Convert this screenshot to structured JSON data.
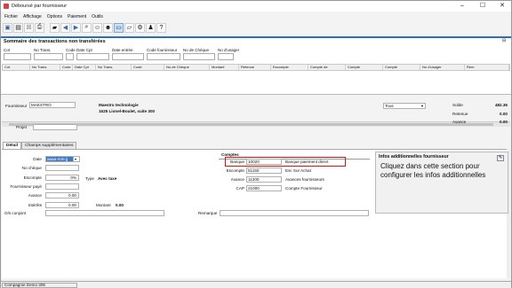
{
  "window": {
    "title": "Déboursé par fournisseur",
    "min": "–",
    "max": "☐",
    "close": "✕"
  },
  "menu": [
    "Fichier",
    "Affichage",
    "Options",
    "Paiement",
    "Outils"
  ],
  "toolbar": {
    "icons": [
      "floppy-icon",
      "new-doc-icon",
      "delete-icon",
      "print-icon",
      "briefcase-icon",
      "back-icon",
      "forward-icon",
      "search-icon",
      "user-icon",
      "users-icon",
      "folder-icon",
      "open-folder-icon",
      "settings-icon",
      "users-group-icon",
      "help-icon"
    ]
  },
  "summary": {
    "title": "Sommaire des transactions non transférées",
    "filters": [
      "Cot",
      "No Trans.",
      "Code",
      "Date Cpt",
      "Date entrée",
      "Code fournisseur",
      "No de Chèque",
      "No d'usager"
    ],
    "columns": [
      "Cot",
      "No Trans.",
      "Code",
      "Date Cpt",
      "No Trans.",
      "Code",
      "No de Chèque",
      "Montant",
      "Retenue",
      "Escompte",
      "Compte de",
      "Compte",
      "Compte",
      "No d'usager",
      "Rem"
    ]
  },
  "supplier": {
    "label": "Fournisseur",
    "code": "MAESTRO",
    "name": "Maestro technologie",
    "address": "1625 Lionel-Boulet, suite 300",
    "project_label": "Projet",
    "dropdown": "Tous",
    "solde_label": "Solde",
    "solde": "482.36",
    "retenue_label": "Retenue",
    "retenue": "0.00",
    "avance_label": "Avance",
    "avance": "0.00"
  },
  "tabs": [
    "Détail",
    "Champs supplémentaires"
  ],
  "detail": {
    "date_label": "Date",
    "date_value": "aaaa-mm-jj",
    "cheque_label": "No chèque",
    "escompte_label": "Escompte",
    "escompte_value": "0%",
    "type_label": "Type",
    "type_value": "Avec taxe",
    "fournisseur_paye_label": "Fournisseur payé",
    "avance_label": "Avance",
    "avance_value": "0.00",
    "interets_label": "Intérêts",
    "interets_value": "0.00",
    "montant_label": "Montant",
    "montant_value": "0.00",
    "os_label": "O/s conjoint",
    "remarque_label": "Remarque"
  },
  "comptes": {
    "title": "Comptes",
    "rows": [
      {
        "label": "Banque",
        "num": "10020",
        "desc": "Banque paiement direct"
      },
      {
        "label": "Escompte",
        "num": "51150",
        "desc": "Esc Sur Achat"
      },
      {
        "label": "Avance",
        "num": "11200",
        "desc": "Avances fournisseurs"
      },
      {
        "label": "CAP",
        "num": "21000",
        "desc": "Compte Fournisseur"
      }
    ]
  },
  "infos": {
    "title": "Infos additionnelles fournisseur",
    "text": "Cliquez dans cette section pour configurer les infos additionnelles"
  },
  "status": {
    "company": "Compagnie Demo 305"
  },
  "colors": {
    "accent_blue": "#2e6fb3",
    "highlight_red": "#d11111"
  }
}
